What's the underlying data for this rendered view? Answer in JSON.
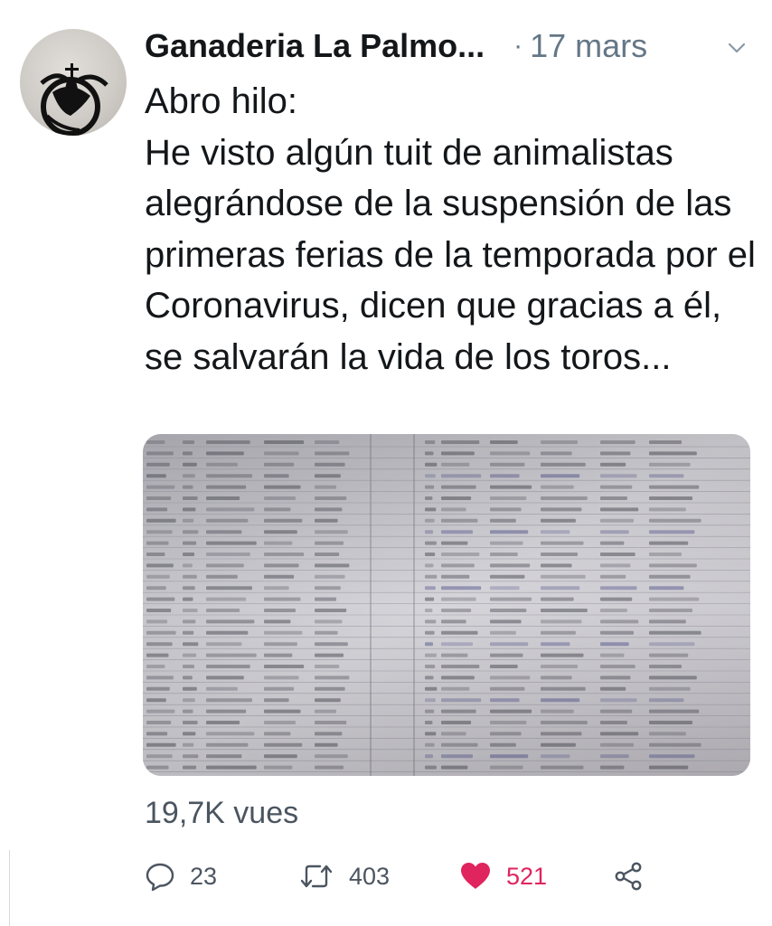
{
  "tweet": {
    "author_name": "Ganaderia La Palmo...",
    "separator": "·",
    "timestamp": "17 mars",
    "text_lines": [
      "Abro hilo:",
      "He visto algún tuit de animalistas alegrándose de la suspensión de las primeras ferias de la temporada por el Coronavirus, dicen que gracias a él, se salvarán la vida de los toros..."
    ],
    "views_label": "19,7K vues",
    "media_description": "photo-of-printed-spreadsheet-list",
    "actions": {
      "reply_count": "23",
      "retweet_count": "403",
      "like_count": "521"
    },
    "colors": {
      "text": "#14171a",
      "muted": "#657786",
      "like": "#e0245e"
    },
    "icons": {
      "reply": "reply-icon",
      "retweet": "retweet-icon",
      "like": "heart-icon",
      "share": "share-icon",
      "menu": "chevron-down-icon"
    }
  }
}
